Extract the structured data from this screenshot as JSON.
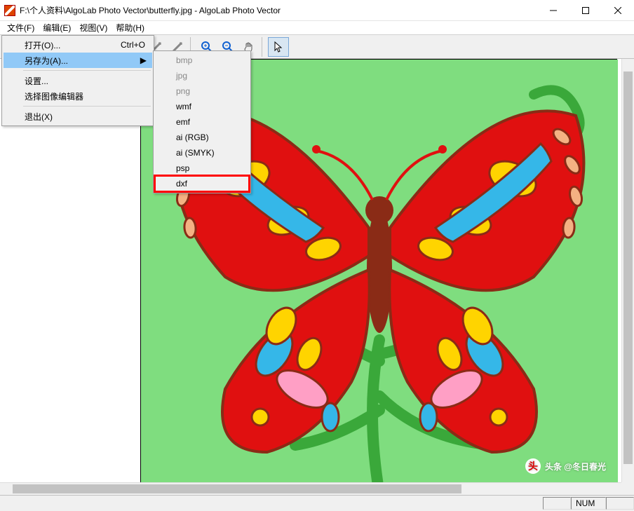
{
  "window": {
    "title": "F:\\个人资料\\AlgoLab Photo Vector\\butterfly.jpg - AlgoLab Photo Vector"
  },
  "menubar": {
    "file": "文件(F)",
    "edit": "编辑(E)",
    "view": "视图(V)",
    "help": "帮助(H)"
  },
  "file_menu": {
    "open": "打开(O)...",
    "open_shortcut": "Ctrl+O",
    "save_as": "另存为(A)...",
    "settings": "设置...",
    "select_editor": "选择图像编辑器",
    "exit": "退出(X)"
  },
  "save_as_menu": {
    "bmp": "bmp",
    "jpg": "jpg",
    "png": "png",
    "wmf": "wmf",
    "emf": "emf",
    "ai_rgb": "ai (RGB)",
    "ai_smyk": "ai (SMYK)",
    "psp": "psp",
    "dxf": "dxf"
  },
  "status": {
    "num": "NUM"
  },
  "watermark": {
    "text": "头条 @冬日春光"
  }
}
